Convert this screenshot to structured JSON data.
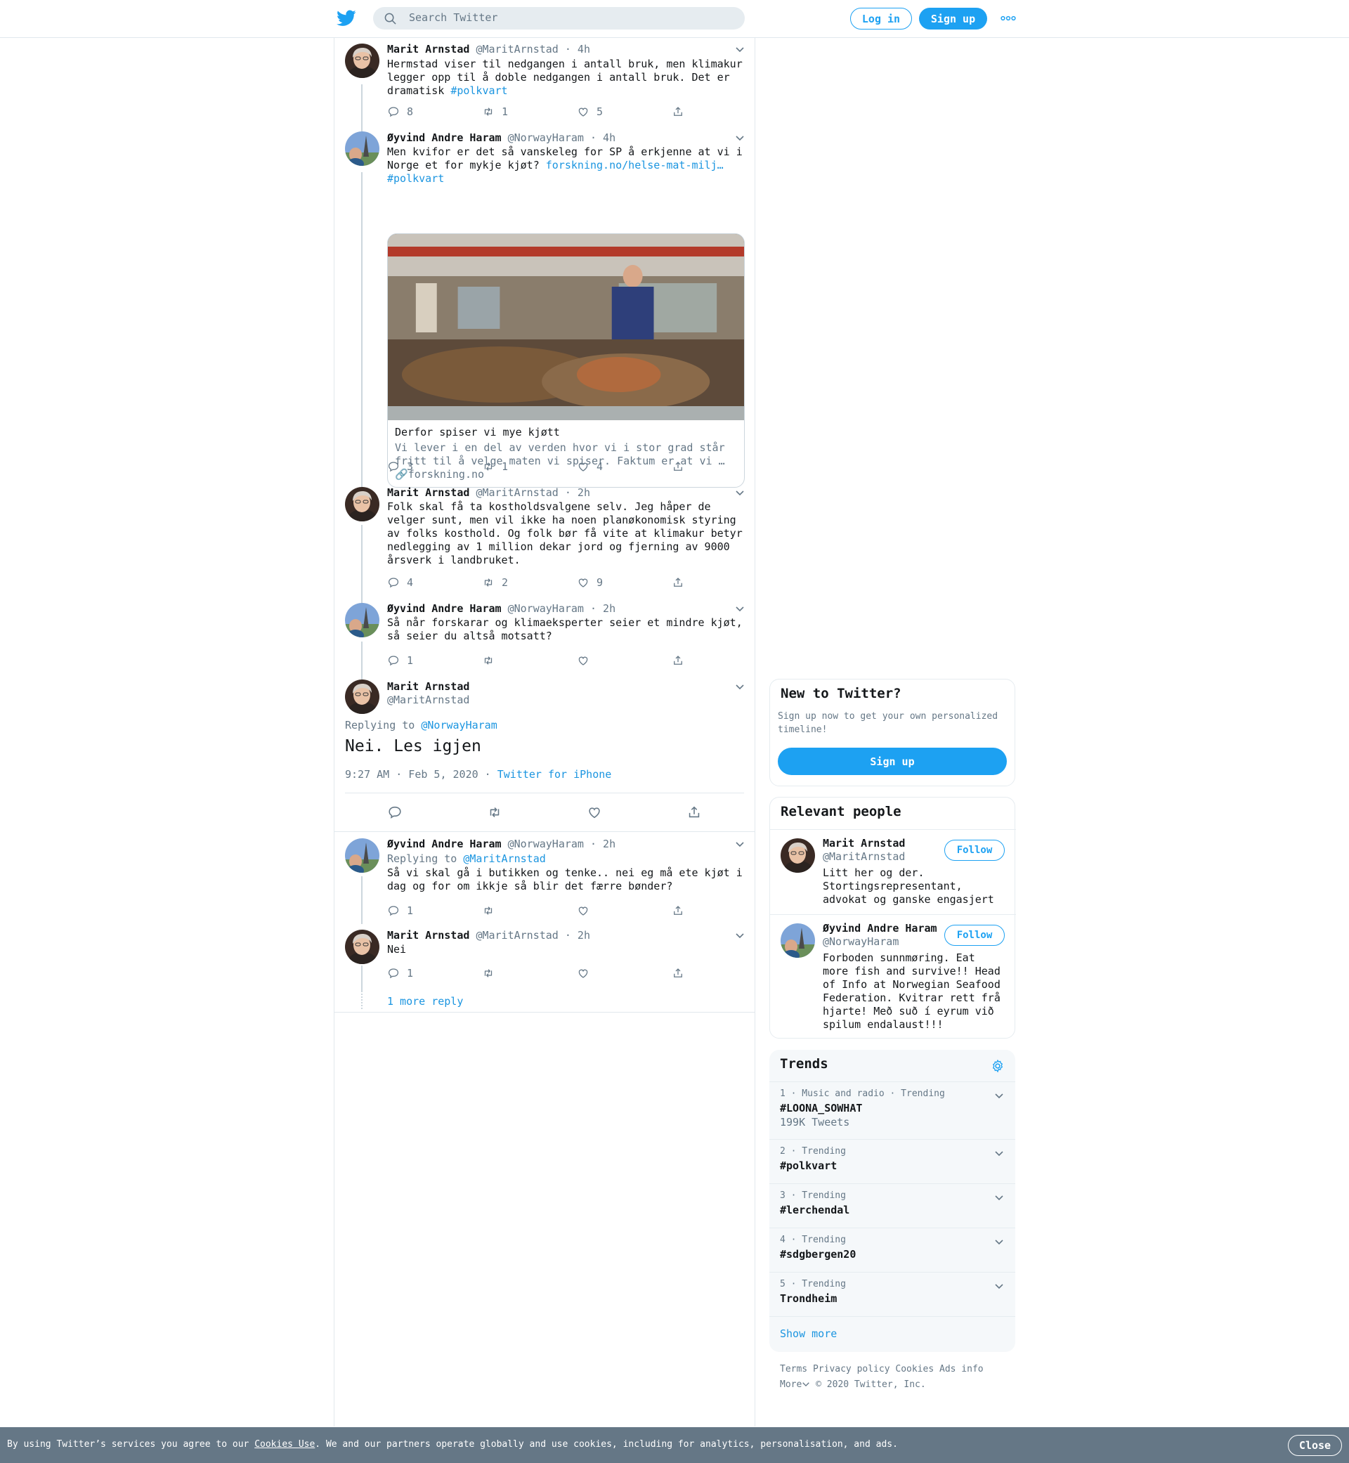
{
  "header": {
    "search_placeholder": "Search Twitter",
    "login_label": "Log in",
    "signup_label": "Sign up"
  },
  "tweets": [
    {
      "name": "Marit Arnstad",
      "handle": "@MaritArnstad",
      "time": "· 4h",
      "text": "Hermstad viser til nedgangen i antall bruk, men klimakur legger opp til å doble nedgangen i antall bruk. Det er dramatisk ",
      "hashtag": "#polkvart",
      "replies": "8",
      "retweets": "1",
      "likes": "5"
    },
    {
      "name": "Øyvind Andre Haram",
      "handle": "@NorwayHaram",
      "time": "· 4h",
      "text": "Men kvifor er det så vanskeleg for SP å erkjenne at vi i Norge et for mykje kjøt? ",
      "link": "forskning.no/helse-mat-milj…",
      "hashtag": "#polkvart",
      "card_title": "Derfor spiser vi mye kjøtt",
      "card_desc": "Vi lever i en del av verden hvor vi i stor grad står fritt til å velge maten vi spiser. Faktum er at vi …",
      "card_domain": "forskning.no",
      "replies": "3",
      "retweets": "1",
      "likes": "4"
    },
    {
      "name": "Marit Arnstad",
      "handle": "@MaritArnstad",
      "time": "· 2h",
      "text": "Folk skal få ta kostholdsvalgene selv. Jeg håper de velger sunt, men vil ikke ha noen planøkonomisk styring av folks kosthold. Og folk bør få vite at klimakur betyr nedlegging av 1 million dekar jord og fjerning av 9000 årsverk i landbruket.",
      "replies": "4",
      "retweets": "2",
      "likes": "9"
    },
    {
      "name": "Øyvind Andre Haram",
      "handle": "@NorwayHaram",
      "time": "· 2h",
      "text": "Så når forskarar og klimaeksperter seier et mindre kjøt, så seier du altså motsatt?",
      "replies": "1",
      "retweets": "",
      "likes": ""
    }
  ],
  "focus": {
    "name": "Marit Arnstad",
    "handle": "@MaritArnstad",
    "replying_prefix": "Replying to ",
    "replying_to": "@NorwayHaram",
    "text": "Nei. Les igjen",
    "timestamp": "9:27 AM · Feb 5, 2020 · ",
    "source": "Twitter for iPhone"
  },
  "replies": [
    {
      "name": "Øyvind Andre Haram",
      "handle": "@NorwayHaram",
      "time": "· 2h",
      "replying_prefix": "Replying to ",
      "replying_to": "@MaritArnstad",
      "text": "Så vi skal gå i butikken og tenke.. nei eg må ete kjøt i dag og for om ikkje så blir det færre bønder?",
      "replies": "1",
      "retweets": "",
      "likes": ""
    },
    {
      "name": "Marit Arnstad",
      "handle": "@MaritArnstad",
      "time": "· 2h",
      "text": "Nei",
      "replies": "1",
      "retweets": "",
      "likes": ""
    }
  ],
  "more_replies": "1 more reply",
  "sidebar": {
    "new_title": "New to Twitter?",
    "new_desc": "Sign up now to get your own personalized timeline!",
    "new_signup": "Sign up",
    "people_title": "Relevant people",
    "people": [
      {
        "name": "Marit Arnstad",
        "handle": "@MaritArnstad",
        "follow": "Follow",
        "bio": "Litt her og der. Stortingsrepresentant, advokat og ganske engasjert"
      },
      {
        "name": "Øyvind Andre Haram",
        "handle": "@NorwayHaram",
        "follow": "Follow",
        "bio": "Forboden sunnmøring. Eat more fish and survive!! Head of Info at Norwegian Seafood Federation. Kvitrar rett frå hjarte! Með suð í eyrum við spilum endalaust!!!"
      }
    ],
    "trends_title": "Trends",
    "trends": [
      {
        "meta": "1 · Music and radio · Trending",
        "name": "#LOONA_SOWHAT",
        "count": "199K Tweets"
      },
      {
        "meta": "2 · Trending",
        "name": "#polkvart",
        "count": ""
      },
      {
        "meta": "3 · Trending",
        "name": "#lerchendal",
        "count": ""
      },
      {
        "meta": "4 · Trending",
        "name": "#sdgbergen20",
        "count": ""
      },
      {
        "meta": "5 · Trending",
        "name": "Trondheim",
        "count": ""
      }
    ],
    "show_more": "Show more",
    "footer": {
      "terms": "Terms",
      "privacy": "Privacy policy",
      "cookies": "Cookies",
      "ads": "Ads info",
      "more": "More",
      "copyright": "© 2020 Twitter, Inc."
    }
  },
  "cookie_bar": {
    "prefix": "By using Twitter’s services you agree to our ",
    "link": "Cookies Use",
    "suffix": ". We and our partners operate globally and use cookies, including for analytics, personalisation, and ads.",
    "close": "Close"
  },
  "colors": {
    "accent": "#1da1f2",
    "link": "#1b95e0",
    "muted": "#657786",
    "border": "#e1e8ed"
  }
}
